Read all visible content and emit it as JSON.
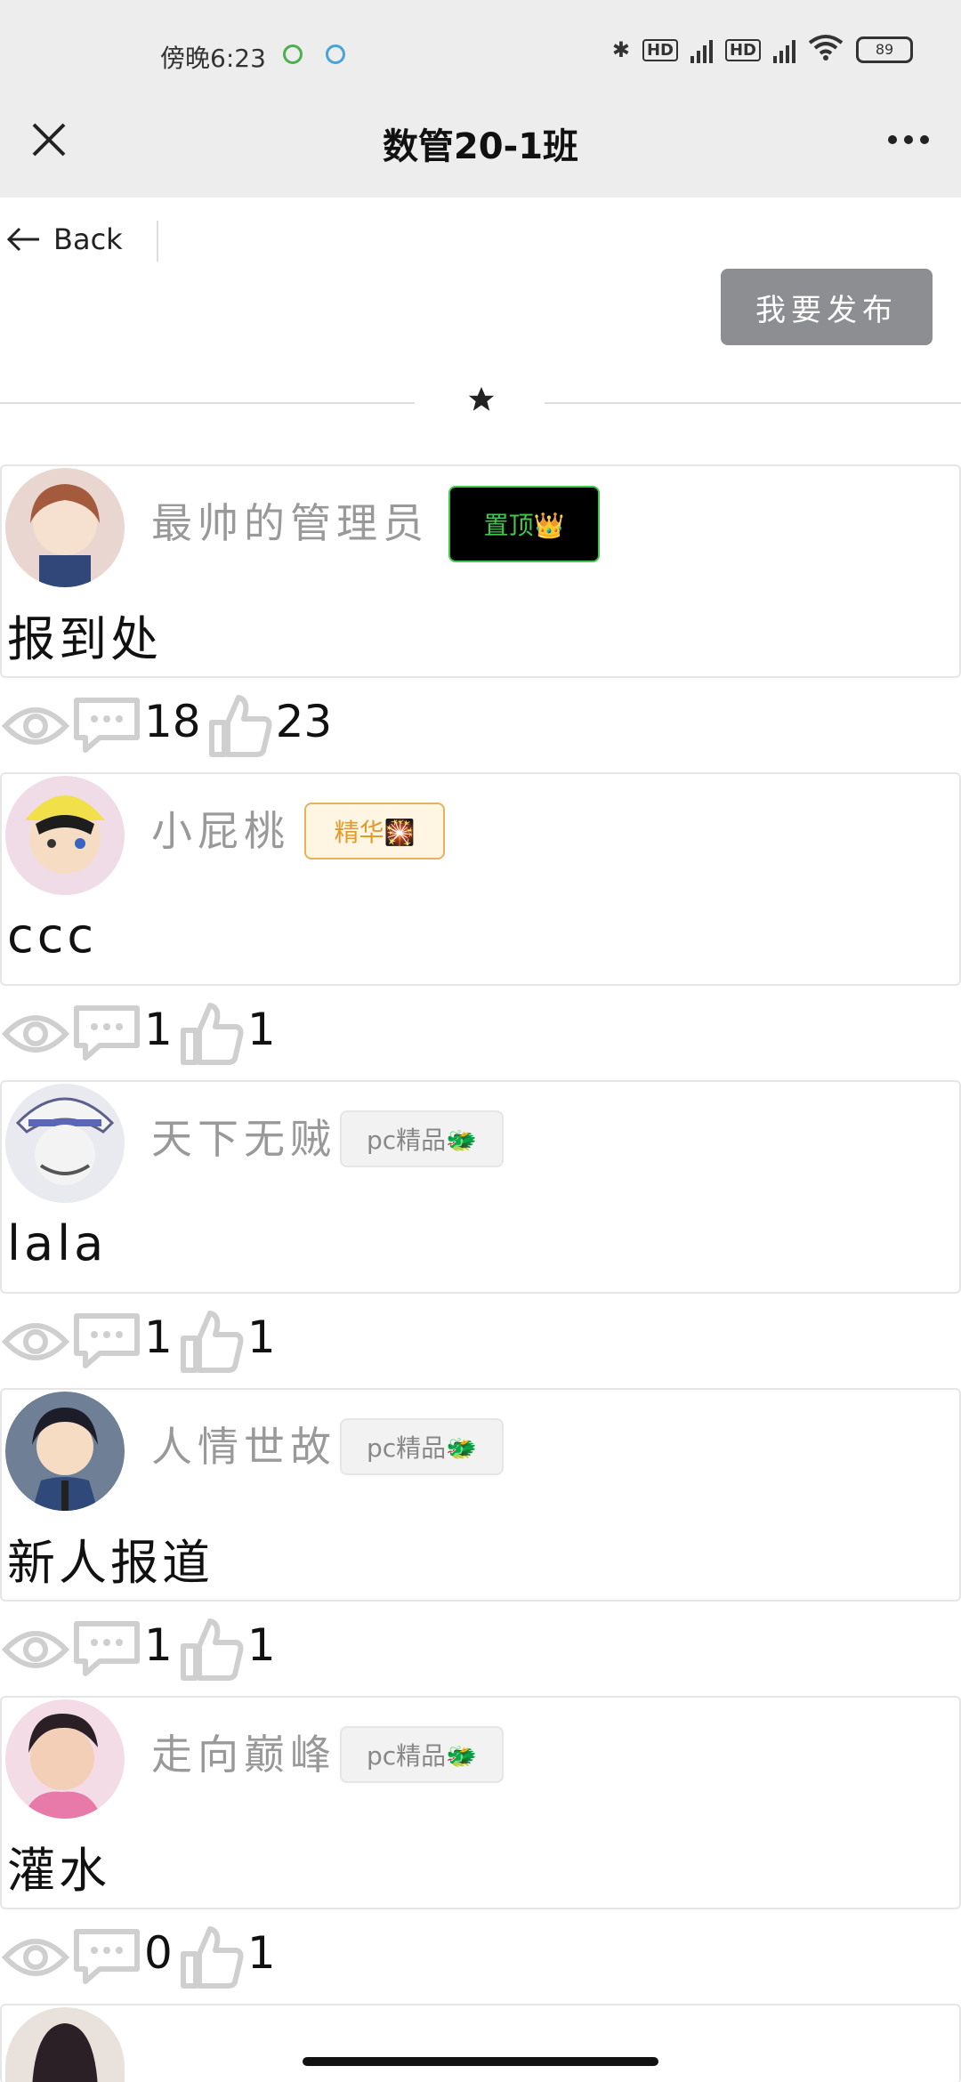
{
  "status_bar": {
    "time": "傍晚6:23",
    "battery": "89",
    "hd1": "HD",
    "hd2": "HD",
    "net1": "4G",
    "net2": "4G"
  },
  "nav": {
    "title": "数管20-1班",
    "close_icon": "close-icon",
    "more_icon": "more-icon"
  },
  "back_label": "Back",
  "publish_label": "我要发布",
  "posts": [
    {
      "author": "最帅的管理员",
      "badge": "置顶👑",
      "badge_type": "top",
      "content": "报到处",
      "comments": "18",
      "likes": "23"
    },
    {
      "author": "小屁桃",
      "badge": "精华🎇",
      "badge_type": "essence",
      "content": "ccc",
      "comments": "1",
      "likes": "1"
    },
    {
      "author": "天下无贼",
      "badge": "pc精品🐲",
      "badge_type": "pc",
      "content": "lala",
      "comments": "1",
      "likes": "1"
    },
    {
      "author": "人情世故",
      "badge": "pc精品🐲",
      "badge_type": "pc",
      "content": "新人报道",
      "comments": "1",
      "likes": "1"
    },
    {
      "author": "走向巅峰",
      "badge": "pc精品🐲",
      "badge_type": "pc",
      "content": "灌水",
      "comments": "0",
      "likes": "1"
    }
  ]
}
